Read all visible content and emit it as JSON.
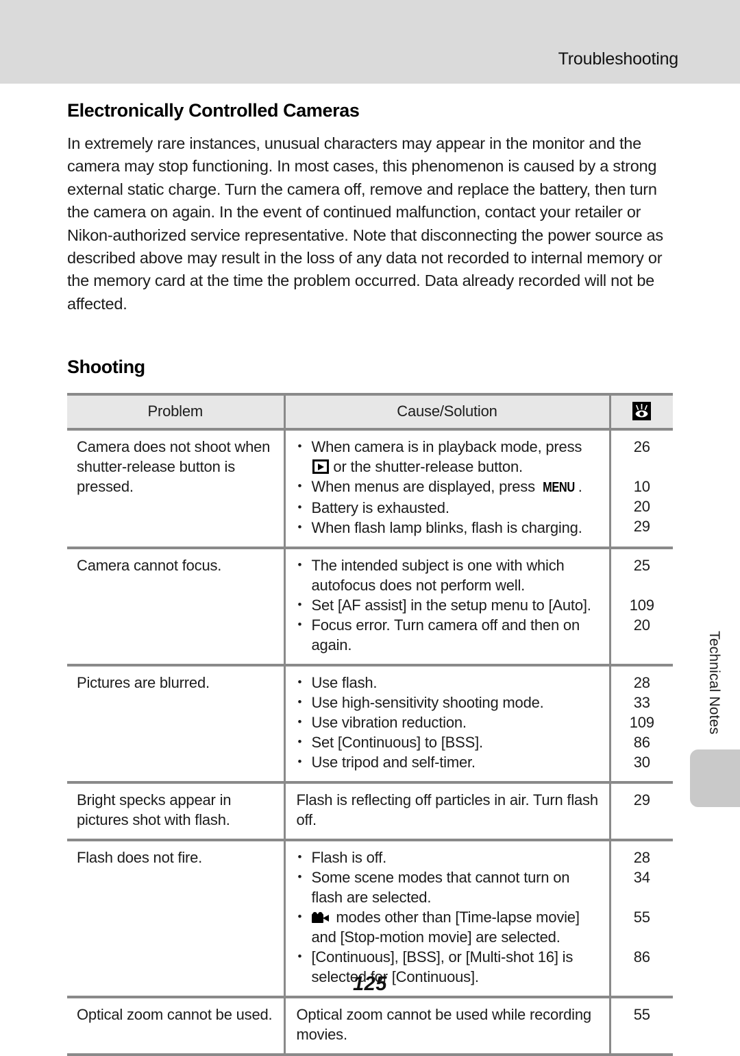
{
  "header": {
    "title": "Troubleshooting"
  },
  "sections": [
    {
      "heading": "Electronically Controlled Cameras",
      "paragraph": "In extremely rare instances, unusual characters may appear in the monitor and the camera may stop functioning. In most cases, this phenomenon is caused by a strong external static charge. Turn the camera off, remove and replace the battery, then turn the camera on again. In the event of continued malfunction, contact your retailer or Nikon-authorized service representative. Note that disconnecting the power source as described above may result in the loss of any data not recorded to internal memory or the memory card at the time the problem occurred. Data already recorded will not be affected."
    },
    {
      "heading": "Shooting"
    }
  ],
  "table": {
    "columns": {
      "problem": "Problem",
      "cause": "Cause/Solution",
      "reference_icon": "reference-page-icon"
    },
    "rows": [
      {
        "problem": "Camera does not shoot when shutter-release button is pressed.",
        "causes": [
          {
            "text_before": "When camera is in playback mode, press ",
            "icon": "playback-icon",
            "text_after": " or the shutter-release button.",
            "page": "26"
          },
          {
            "text_before": "When menus are displayed, press ",
            "icon": "menu-icon",
            "text_after": ".",
            "page": "10"
          },
          {
            "text_before": "Battery is exhausted.",
            "page": "20"
          },
          {
            "text_before": "When flash lamp blinks, flash is charging.",
            "page": "29"
          }
        ]
      },
      {
        "problem": "Camera cannot focus.",
        "causes": [
          {
            "text_before": "The intended subject is one with which autofocus does not perform well.",
            "page": "25"
          },
          {
            "text_before": "Set [AF assist] in the setup menu to [Auto].",
            "page": "109"
          },
          {
            "text_before": "Focus error. Turn camera off and then on again.",
            "page": "20"
          }
        ]
      },
      {
        "problem": "Pictures are blurred.",
        "causes": [
          {
            "text_before": "Use flash.",
            "page": "28"
          },
          {
            "text_before": "Use high-sensitivity shooting mode.",
            "page": "33"
          },
          {
            "text_before": "Use vibration reduction.",
            "page": "109"
          },
          {
            "text_before": "Set [Continuous] to [BSS].",
            "page": "86"
          },
          {
            "text_before": "Use tripod and self-timer.",
            "page": "30"
          }
        ]
      },
      {
        "problem": "Bright specks appear in pictures shot with flash.",
        "causes": [
          {
            "text_before": "Flash is reflecting off particles in air. Turn flash off.",
            "bullet": false,
            "page": "29"
          }
        ]
      },
      {
        "problem": "Flash does not fire.",
        "causes": [
          {
            "text_before": "Flash is off.",
            "page": "28"
          },
          {
            "text_before": "Some scene modes that cannot turn on flash are selected.",
            "page": "34"
          },
          {
            "icon": "movie-icon",
            "text_after": " modes other than [Time-lapse movie] and [Stop-motion movie] are selected.",
            "page": "55"
          },
          {
            "text_before": "[Continuous], [BSS], or [Multi-shot 16] is selected for [Continuous].",
            "page": "86"
          }
        ]
      },
      {
        "problem": "Optical zoom cannot be used.",
        "causes": [
          {
            "text_before": "Optical zoom cannot be used while recording movies.",
            "bullet": false,
            "page": "55"
          }
        ]
      }
    ]
  },
  "side_tab": {
    "label": "Technical Notes"
  },
  "footer": {
    "page_number": "125"
  },
  "colors": {
    "header_band": "#dadada",
    "table_rule": "#8a8a8a",
    "table_header_fill": "#e7e7e7",
    "side_tab": "#c9c9c9",
    "text": "#1c1c1c"
  }
}
